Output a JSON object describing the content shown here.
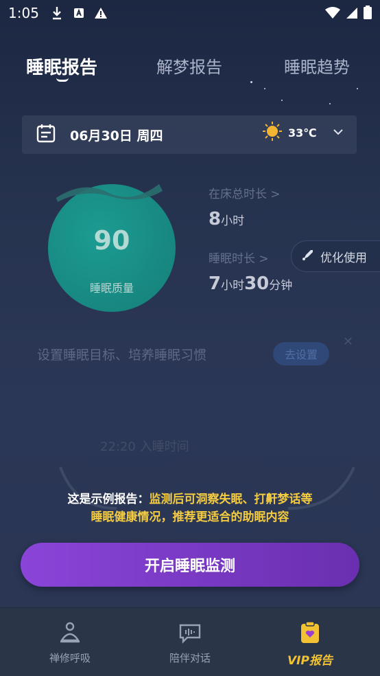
{
  "status_bar": {
    "time": "1:05"
  },
  "tabs": [
    {
      "label": "睡眠报告",
      "active": true
    },
    {
      "label": "解梦报告",
      "active": false
    },
    {
      "label": "睡眠趋势",
      "active": false
    }
  ],
  "date_bar": {
    "date": "06月30日 周四",
    "temperature": "33℃"
  },
  "sleep": {
    "score": "90",
    "score_label": "睡眠质量",
    "in_bed_label": "在床总时长 >",
    "in_bed_num": "8",
    "in_bed_unit": "小时",
    "sleep_label": "睡眠时长 >",
    "sleep_h": "7",
    "sleep_h_unit": "小时",
    "sleep_m": "30",
    "sleep_m_unit": "分钟"
  },
  "optimize_button": "优化使用",
  "goal": {
    "text": "设置睡眠目标、培养睡眠习惯",
    "button": "去设置"
  },
  "sleep_time": "22:20 入睡时间",
  "notice": {
    "line1_prefix": "这是示例报告：",
    "line1_highlight": "监测后可洞察失眠、打鼾梦话等",
    "line2": "睡眠健康情况，推荐更适合的助眠内容"
  },
  "main_button": "开启睡眠监测",
  "bottom_nav": [
    {
      "label": "禅修呼吸",
      "icon": "meditation-icon"
    },
    {
      "label": "陪伴对话",
      "icon": "chat-voice-icon"
    },
    {
      "label": "VIP报告",
      "icon": "vip-report-icon",
      "active": true
    }
  ],
  "colors": {
    "accent": "#f5cc3f",
    "button": "#8a45d8",
    "circle": "#1c9c92"
  }
}
